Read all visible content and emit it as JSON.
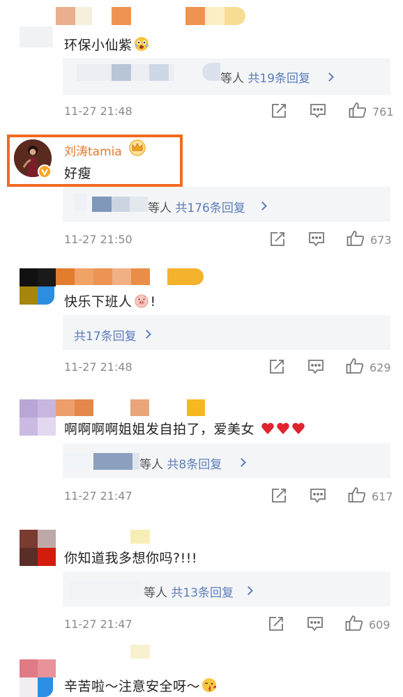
{
  "comments": [
    {
      "text": "环保小仙紫",
      "emoji": "emoji-surprised",
      "reply_prefix": "等人",
      "reply_link": "共19条回复",
      "time": "11-27 21:48",
      "likes": "761"
    },
    {
      "username": "刘涛tamia",
      "text": "好瘦",
      "reply_prefix": "等人",
      "reply_link": "共176条回复",
      "time": "11-27 21:50",
      "likes": "673",
      "highlight_color": "#f26a21",
      "username_color": "#e07a2e"
    },
    {
      "text": "快乐下班人",
      "text_suffix": "!",
      "emoji": "emoji-pig",
      "reply_link": "共17条回复",
      "time": "11-27 21:48",
      "likes": "629"
    },
    {
      "text": "啊啊啊啊姐姐发自拍了，爱美女",
      "emoji": "heart-icons",
      "reply_prefix": "等人",
      "reply_link": "共8条回复",
      "time": "11-27 21:47",
      "likes": "617"
    },
    {
      "text": "你知道我多想你吗?!!!",
      "reply_prefix": "等人",
      "reply_link": "共13条回复",
      "time": "11-27 21:47",
      "likes": "609"
    },
    {
      "text": "辛苦啦～注意安全呀～",
      "emoji": "emoji-kiss"
    }
  ],
  "colors": {
    "link": "#5b7dba",
    "meta": "#8a8a8a",
    "highlight": "#f26a21",
    "verified": "#f5a623",
    "heart": "#e0242f"
  }
}
